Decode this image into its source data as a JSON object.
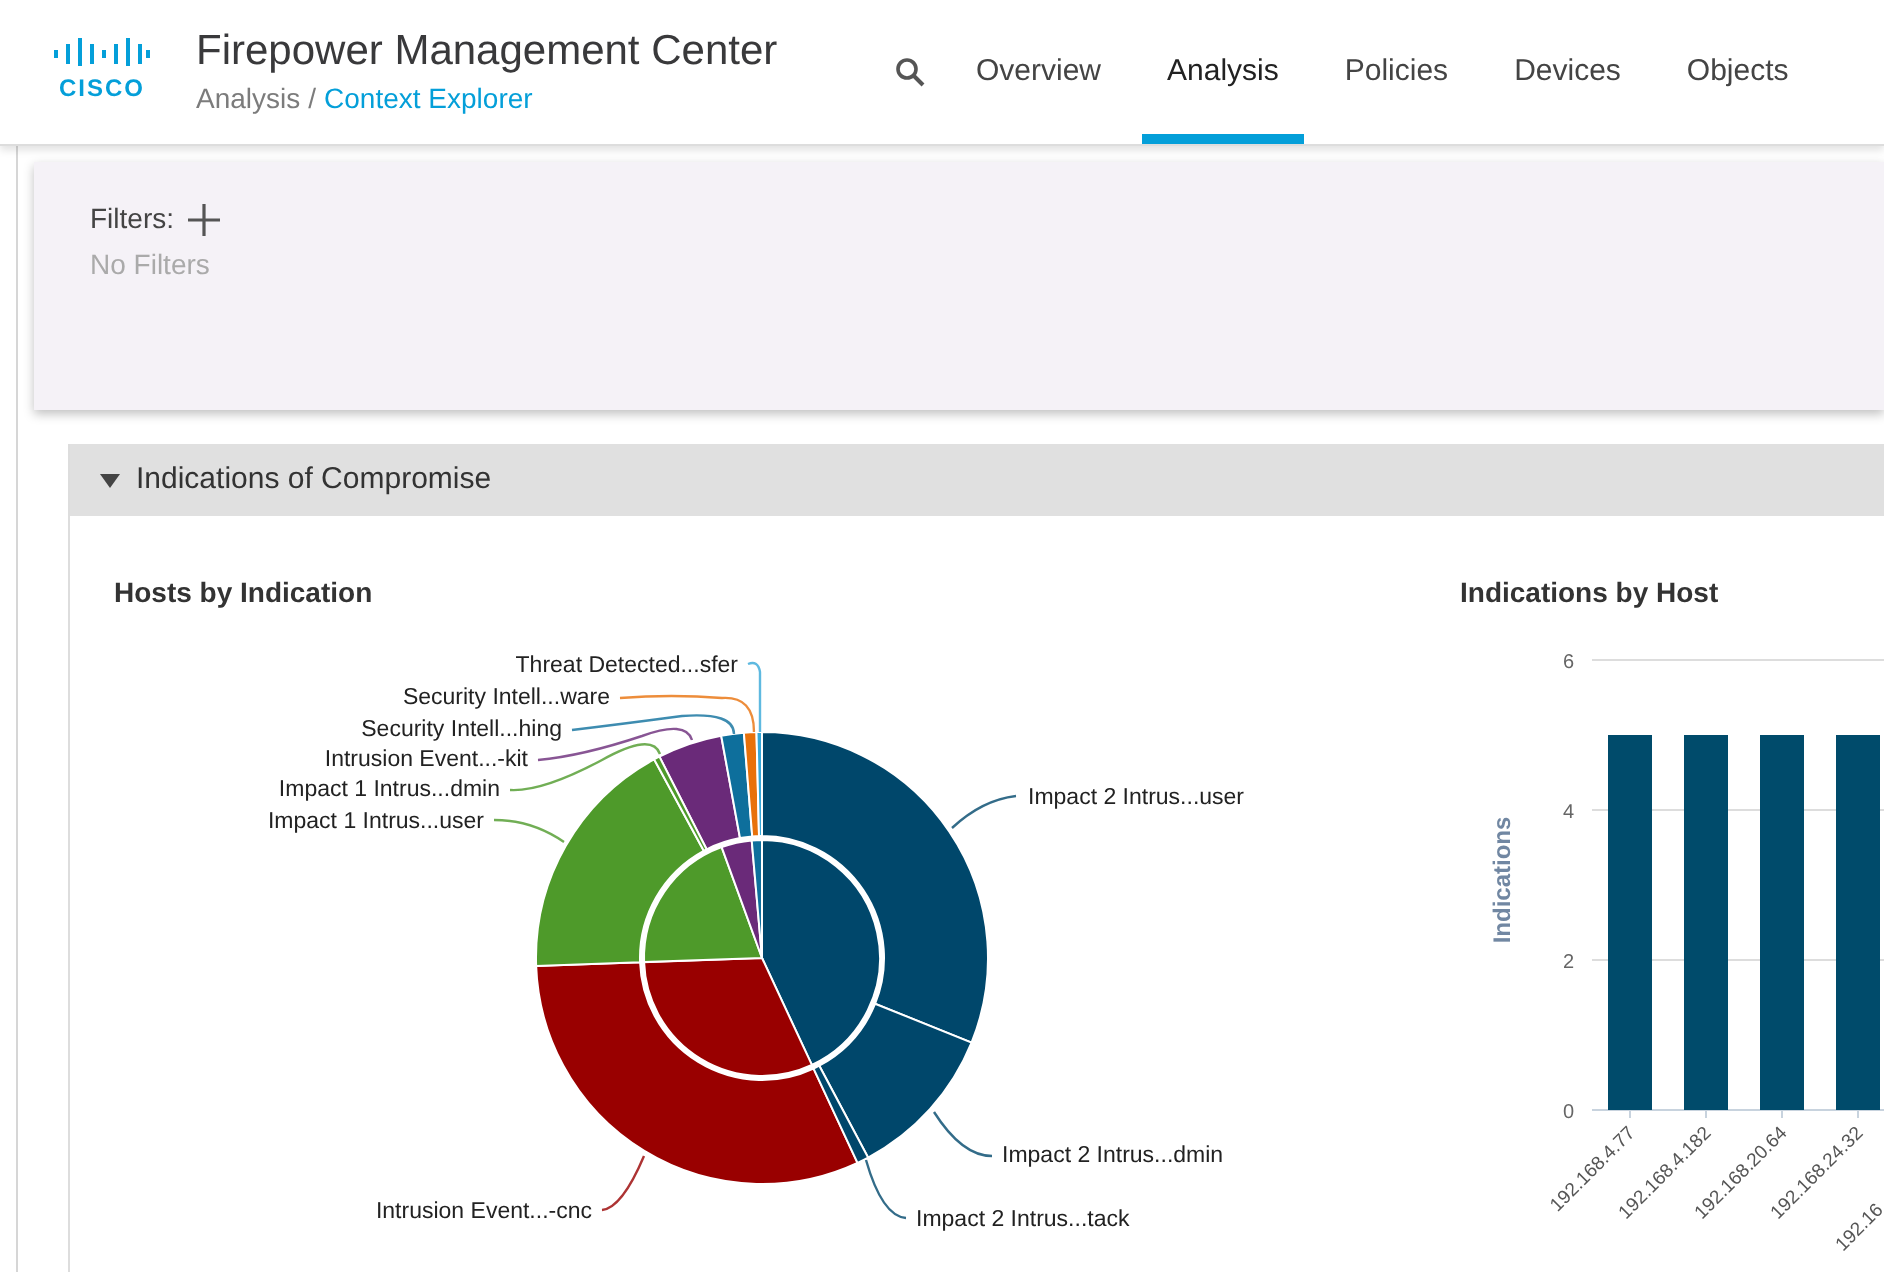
{
  "header": {
    "logo_text": "CISCO",
    "product_title": "Firepower Management Center",
    "breadcrumb_separator": "/",
    "breadcrumb": [
      {
        "label": "Analysis",
        "link": false
      },
      {
        "label": "Context Explorer",
        "link": true
      }
    ]
  },
  "nav": [
    {
      "label": "Overview",
      "selected": false
    },
    {
      "label": "Analysis",
      "selected": true
    },
    {
      "label": "Policies",
      "selected": false
    },
    {
      "label": "Devices",
      "selected": false
    },
    {
      "label": "Objects",
      "selected": false
    }
  ],
  "filters": {
    "label": "Filters:",
    "empty_text": "No Filters"
  },
  "section": {
    "title": "Indications of Compromise",
    "expanded": true
  },
  "hosts_by_indication": {
    "title": "Hosts by Indication",
    "slices": [
      {
        "label": "Threat Detected...sfer",
        "color": "#36a8d8"
      },
      {
        "label": "Security Intell...ware",
        "color": "#e8710a"
      },
      {
        "label": "Security Intell...hing",
        "color": "#0e6f9c"
      },
      {
        "label": "Intrusion Event...-kit",
        "color": "#6a2a79"
      },
      {
        "label": "Impact 1 Intrus...dmin",
        "color": "#4e9a2a"
      },
      {
        "label": "Impact 1 Intrus...user",
        "color": "#4e9a2a"
      },
      {
        "label": "Impact 2 Intrus...user",
        "color": "#00476b"
      },
      {
        "label": "Impact 2 Intrus...dmin",
        "color": "#00476b"
      },
      {
        "label": "Impact 2 Intrus...tack",
        "color": "#00476b"
      },
      {
        "label": "Intrusion Event...-cnc",
        "color": "#990000"
      }
    ]
  },
  "indications_by_host": {
    "title": "Indications by Host",
    "partial_x_label": "192.16",
    "chart_data": {
      "type": "bar",
      "ylabel": "Indications",
      "categories": [
        "192.168.4.77",
        "192.168.4.182",
        "192.168.20.64",
        "192.168.24.32"
      ],
      "series": [
        {
          "color": "#004b6b",
          "values": [
            5,
            5,
            5,
            5
          ]
        }
      ],
      "ylim": [
        0,
        6
      ],
      "yticks": [
        0,
        2,
        4,
        6
      ]
    }
  }
}
